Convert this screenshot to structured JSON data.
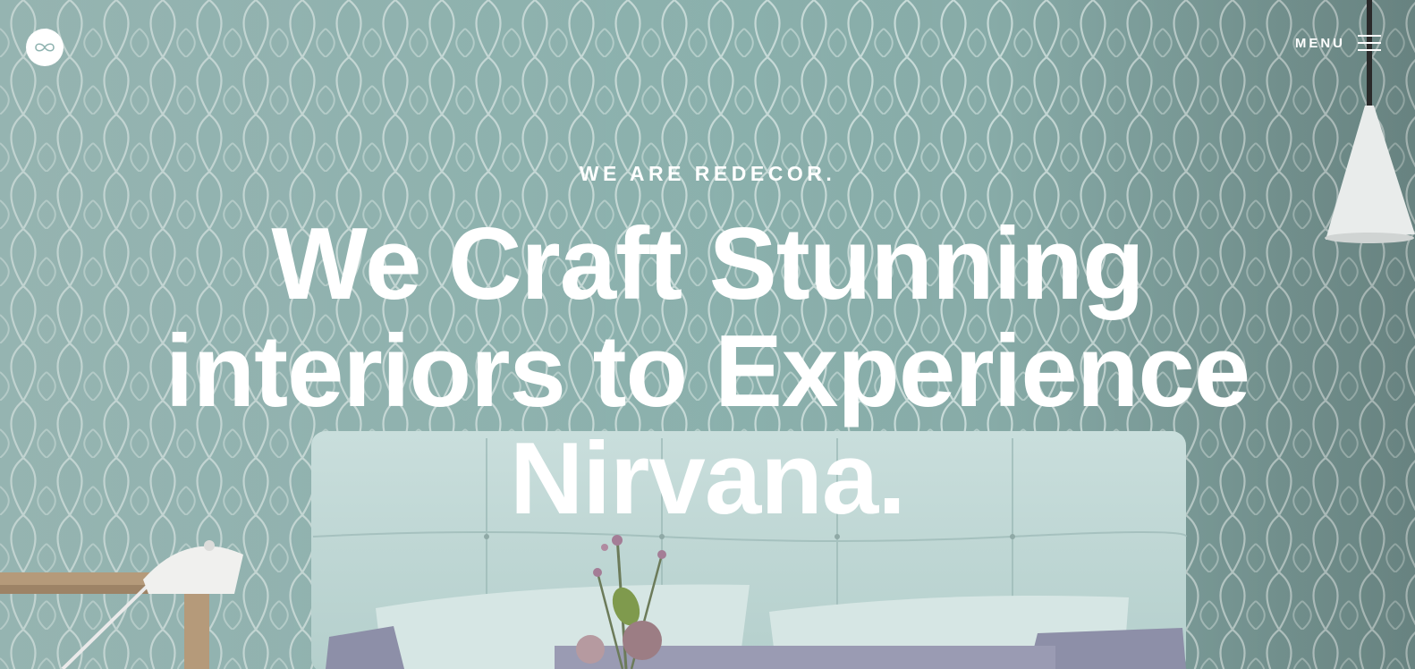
{
  "header": {
    "logo_icon": "infinity-icon",
    "menu_label": "MENU",
    "menu_icon": "hamburger-icon"
  },
  "hero": {
    "eyebrow": "WE ARE REDECOR.",
    "headline_lines": [
      "We Craft Stunning",
      "interiors to Experience",
      "Nirvana."
    ],
    "background_image": "bedroom-interior-photo"
  },
  "colors": {
    "text": "#ffffff",
    "wall_teal": "#8fb3b0",
    "sofa_mint": "#c5dcda"
  }
}
